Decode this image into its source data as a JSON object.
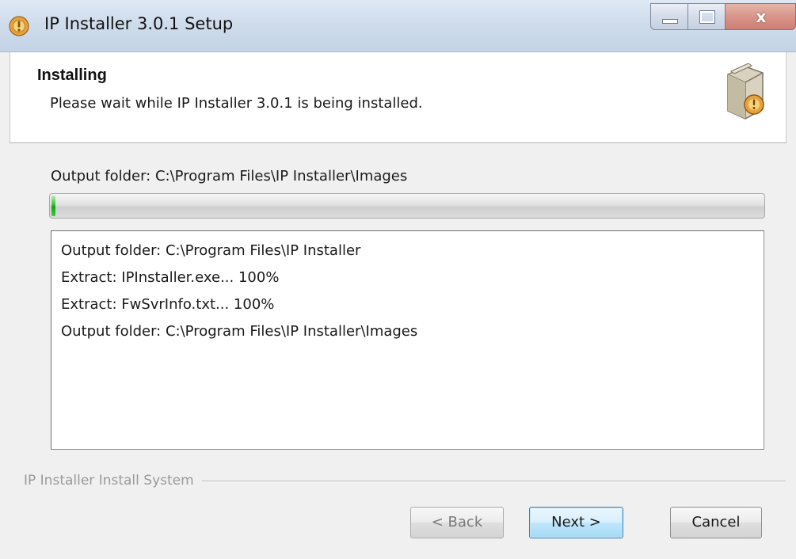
{
  "window": {
    "title": "IP Installer 3.0.1 Setup",
    "app_icon": "installer-disc-icon",
    "caption_buttons": {
      "minimize_icon": "minimize-icon",
      "maximize_icon": "maximize-icon",
      "close_glyph": "x",
      "close_icon": "close-icon"
    }
  },
  "header": {
    "title": "Installing",
    "subtitle": "Please wait while IP Installer 3.0.1 is being installed.",
    "icon": "installer-box-icon"
  },
  "status": {
    "text": "Output folder: C:\\Program Files\\IP Installer\\Images"
  },
  "progress": {
    "fraction": 0.006,
    "color": "#16a11a"
  },
  "log": {
    "lines": [
      "Output folder: C:\\Program Files\\IP Installer",
      "Extract: IPInstaller.exe... 100%",
      "Extract: FwSvrInfo.txt... 100%",
      "Output folder: C:\\Program Files\\IP Installer\\Images"
    ]
  },
  "branding": {
    "text": "IP Installer Install System"
  },
  "buttons": {
    "back": "< Back",
    "next": "Next >",
    "cancel": "Cancel"
  },
  "colors": {
    "accent": "#3c7fb1",
    "close_red": "#cc7e74"
  }
}
